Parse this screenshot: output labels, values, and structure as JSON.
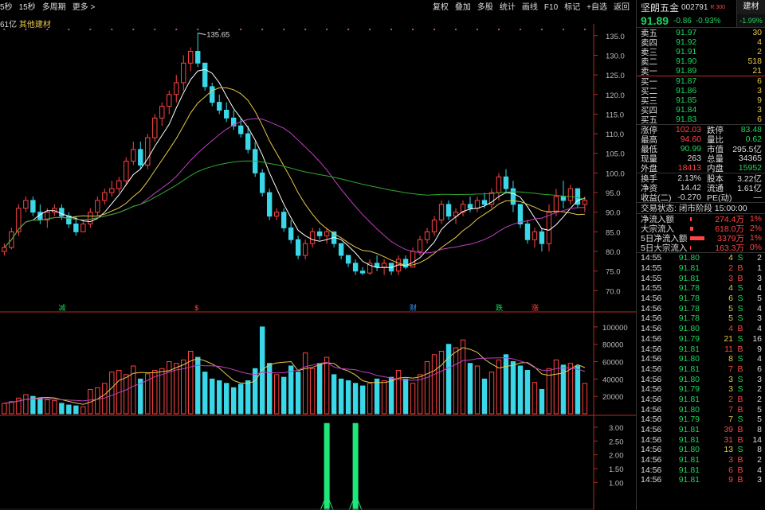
{
  "topbar": {
    "left": [
      "5秒",
      "15秒",
      "多周期",
      "更多 >"
    ],
    "right": [
      "复权",
      "叠加",
      "多股",
      "统计",
      "画线",
      "F10",
      "标记",
      "+自选",
      "返回"
    ]
  },
  "sector_line": {
    "cap": "61亿",
    "sector": "其他建材"
  },
  "header_icons": {
    "search": "search-icon",
    "settings": "gear-icon"
  },
  "colors": {
    "up": "#ff4444",
    "down": "#3ad7e8",
    "ma5": "#ffffff",
    "ma10": "#e8c84a",
    "ma20": "#c040c0",
    "ma60": "#2faa2f"
  },
  "events": [
    {
      "label": "减",
      "color": "#1fd35c"
    },
    {
      "label": "$",
      "color": "#ff4444"
    },
    {
      "label": "财",
      "color": "#3a9bff"
    },
    {
      "label": "跌",
      "color": "#1fd35c"
    },
    {
      "label": "涨",
      "color": "#ff4444"
    }
  ],
  "chart_data": [
    {
      "type": "candlestick",
      "title": "",
      "y_ticks": [
        "135.0",
        "130.0",
        "125.0",
        "120.0",
        "115.0",
        "110.0",
        "105.0",
        "100.0",
        "95.0",
        "90.0",
        "85.0",
        "80.0",
        "75.0",
        "70.0"
      ],
      "ylim": [
        65,
        138
      ],
      "max_label": "135.65",
      "candles": [
        [
          80,
          82,
          79,
          81
        ],
        [
          81,
          86,
          80.5,
          85
        ],
        [
          85,
          92,
          84,
          91
        ],
        [
          91,
          94,
          90,
          93
        ],
        [
          93,
          94,
          89,
          90
        ],
        [
          90,
          92,
          87,
          88
        ],
        [
          88,
          91,
          86,
          90
        ],
        [
          90,
          92,
          89,
          91
        ],
        [
          91,
          92,
          88,
          89
        ],
        [
          89,
          90,
          86,
          87
        ],
        [
          87,
          89,
          84,
          85
        ],
        [
          85,
          88,
          85,
          87
        ],
        [
          87,
          91,
          86,
          90
        ],
        [
          90,
          94,
          89,
          93
        ],
        [
          93,
          96,
          92,
          95
        ],
        [
          95,
          98,
          94,
          96
        ],
        [
          96,
          99,
          95,
          98
        ],
        [
          98,
          104,
          97,
          103
        ],
        [
          103,
          108,
          102,
          106
        ],
        [
          106,
          108,
          101,
          102
        ],
        [
          102,
          110,
          101,
          109
        ],
        [
          109,
          115,
          108,
          114
        ],
        [
          114,
          118,
          112,
          117
        ],
        [
          117,
          121,
          115,
          120
        ],
        [
          120,
          125,
          118,
          123
        ],
        [
          123,
          130,
          121,
          128
        ],
        [
          128,
          132,
          126,
          131
        ],
        [
          131,
          135.65,
          127,
          128
        ],
        [
          128,
          127.5,
          121,
          122
        ],
        [
          122,
          123,
          117,
          118
        ],
        [
          118,
          120,
          115,
          116
        ],
        [
          116,
          118,
          113,
          114
        ],
        [
          114,
          116,
          111,
          112
        ],
        [
          112,
          114,
          109,
          110
        ],
        [
          110,
          112,
          105,
          106
        ],
        [
          106,
          108,
          99,
          100
        ],
        [
          100,
          101,
          94,
          95
        ],
        [
          95,
          96,
          88,
          89
        ],
        [
          89,
          91,
          88,
          90
        ],
        [
          90,
          91,
          85,
          86
        ],
        [
          86,
          88,
          82,
          83
        ],
        [
          83,
          84,
          78,
          79
        ],
        [
          79,
          83,
          78,
          82
        ],
        [
          82,
          86,
          81,
          85
        ],
        [
          85,
          86,
          83,
          84
        ],
        [
          84,
          86,
          82,
          85
        ],
        [
          85,
          85,
          81,
          82
        ],
        [
          82,
          82,
          78,
          79
        ],
        [
          79,
          79,
          76,
          77
        ],
        [
          77,
          78,
          74,
          75
        ],
        [
          75,
          76,
          74,
          74.5
        ],
        [
          74.5,
          78,
          74,
          77
        ],
        [
          77,
          79,
          75,
          76
        ],
        [
          76,
          78,
          74,
          77
        ],
        [
          77,
          77,
          74,
          75
        ],
        [
          75,
          79,
          74,
          78
        ],
        [
          78,
          79,
          75.5,
          76
        ],
        [
          76,
          81,
          76,
          80
        ],
        [
          80,
          84,
          79,
          83
        ],
        [
          83,
          86,
          82,
          85
        ],
        [
          85,
          89,
          84,
          88
        ],
        [
          88,
          93,
          87,
          92
        ],
        [
          92,
          93,
          88,
          89
        ],
        [
          89,
          91,
          87,
          90
        ],
        [
          90,
          93,
          89,
          92
        ],
        [
          92,
          94,
          90,
          91
        ],
        [
          91,
          94,
          90,
          93
        ],
        [
          93,
          95,
          91,
          92
        ],
        [
          92,
          96,
          91,
          95
        ],
        [
          95,
          100,
          93,
          99
        ],
        [
          99,
          101,
          95,
          96
        ],
        [
          96,
          98,
          90,
          92
        ],
        [
          92,
          92,
          86,
          87
        ],
        [
          87,
          88,
          82,
          83
        ],
        [
          83,
          86,
          81,
          85
        ],
        [
          85,
          86,
          80,
          82
        ],
        [
          82,
          92,
          80,
          90
        ],
        [
          90,
          96,
          89,
          94
        ],
        [
          94,
          98,
          91,
          93
        ],
        [
          93,
          97,
          92,
          96
        ],
        [
          96,
          96,
          91,
          92
        ],
        [
          92,
          94,
          90,
          93
        ]
      ],
      "ma": {
        "ma5": true,
        "ma10": true,
        "ma20": true,
        "ma60": true
      }
    },
    {
      "type": "bar",
      "title": "volume",
      "y_ticks": [
        "100000",
        "80000",
        "60000",
        "40000",
        "20000"
      ],
      "ylim": [
        0,
        110000
      ],
      "values": [
        12000,
        14000,
        18000,
        22000,
        20000,
        18000,
        16000,
        15000,
        12000,
        10000,
        9000,
        8000,
        28000,
        30000,
        35000,
        48000,
        50000,
        45000,
        55000,
        40000,
        46000,
        50000,
        52000,
        60000,
        58000,
        62000,
        72000,
        65000,
        48000,
        40000,
        38000,
        35000,
        30000,
        34000,
        38000,
        52000,
        100000,
        58000,
        45000,
        42000,
        55000,
        48000,
        70000,
        52000,
        58000,
        65000,
        45000,
        40000,
        38000,
        35000,
        32000,
        35000,
        40000,
        38000,
        42000,
        50000,
        40000,
        35000,
        45000,
        60000,
        68000,
        72000,
        80000,
        76000,
        85000,
        58000,
        55000,
        40000,
        48000,
        62000,
        68000,
        60000,
        55000,
        50000,
        36000,
        28000,
        52000,
        62000,
        56000,
        58000,
        55000,
        35000
      ]
    },
    {
      "type": "bar",
      "title": "indicator",
      "y_ticks": [
        "3.00",
        "2.50",
        "2.00",
        "1.50",
        "1.00"
      ],
      "ylim": [
        0,
        3.2
      ],
      "spikes": [
        {
          "index": 45,
          "value": 3.15
        },
        {
          "index": 49,
          "value": 3.15
        }
      ]
    }
  ],
  "panel": {
    "name": "坚朗五金",
    "code": "002791",
    "rmark": "R 300",
    "sector_tag": "建材",
    "price": "91.89",
    "change": "-0.86",
    "pct": "-0.93%",
    "sector_pct": "-1.99%",
    "asks": [
      {
        "label": "卖五",
        "price": "91.97",
        "vol": "30"
      },
      {
        "label": "卖四",
        "price": "91.92",
        "vol": "4"
      },
      {
        "label": "卖三",
        "price": "91.91",
        "vol": "2"
      },
      {
        "label": "卖二",
        "price": "91.90",
        "vol": "518"
      },
      {
        "label": "卖一",
        "price": "91.89",
        "vol": "21"
      }
    ],
    "bids": [
      {
        "label": "买一",
        "price": "91.87",
        "vol": "6"
      },
      {
        "label": "买二",
        "price": "91.86",
        "vol": "3"
      },
      {
        "label": "买三",
        "price": "91.85",
        "vol": "9"
      },
      {
        "label": "买四",
        "price": "91.84",
        "vol": "3"
      },
      {
        "label": "买五",
        "price": "91.83",
        "vol": "6"
      }
    ],
    "stats1": [
      {
        "k": "涨停",
        "v": "102.03",
        "vc": "c-red",
        "k2": "跌停",
        "v2": "83.48",
        "v2c": "c-green"
      },
      {
        "k": "最高",
        "v": "94.60",
        "vc": "c-red",
        "k2": "量比",
        "v2": "0.62",
        "v2c": "c-green"
      },
      {
        "k": "最低",
        "v": "90.99",
        "vc": "c-green",
        "k2": "市值",
        "v2": "295.5亿",
        "v2c": "c-white"
      },
      {
        "k": "现量",
        "v": "263",
        "vc": "c-white",
        "k2": "总量",
        "v2": "34365",
        "v2c": "c-white"
      },
      {
        "k": "外盘",
        "v": "18413",
        "vc": "c-red",
        "k2": "内盘",
        "v2": "15952",
        "v2c": "c-green"
      }
    ],
    "stats2": [
      {
        "k": "换手",
        "v": "2.13%",
        "vc": "c-white",
        "k2": "股本",
        "v2": "3.22亿",
        "v2c": "c-white"
      },
      {
        "k": "净资",
        "v": "14.42",
        "vc": "c-white",
        "k2": "流通",
        "v2": "1.61亿",
        "v2c": "c-white"
      },
      {
        "k": "收益(二)",
        "v": "-0.270",
        "vc": "c-white",
        "k2": "PE(动)",
        "v2": "—",
        "v2c": "c-white"
      }
    ],
    "status": "交易状态: 闭市阶段 15:00:00",
    "flows": [
      {
        "k": "净流入额",
        "v": "274.4万",
        "p": "1%",
        "bar": 0.1
      },
      {
        "k": "大宗流入",
        "v": "618.0万",
        "p": "2%",
        "bar": 0.2
      },
      {
        "k": "5日净流入额",
        "v": "3379万",
        "p": "1%",
        "bar": 1.0
      },
      {
        "k": "5日大宗流入",
        "v": "163.3万",
        "p": "0%",
        "bar": 0.05
      }
    ],
    "ticks": [
      {
        "t": "14:55",
        "p": "91.80",
        "q": "4",
        "bs": "S",
        "n": "2"
      },
      {
        "t": "14:55",
        "p": "91.81",
        "q": "2",
        "bs": "B",
        "n": "1"
      },
      {
        "t": "14:55",
        "p": "91.81",
        "q": "3",
        "bs": "B",
        "n": "3"
      },
      {
        "t": "14:55",
        "p": "91.78",
        "q": "4",
        "bs": "S",
        "n": "4"
      },
      {
        "t": "14:56",
        "p": "91.78",
        "q": "6",
        "bs": "S",
        "n": "5"
      },
      {
        "t": "14:56",
        "p": "91.78",
        "q": "5",
        "bs": "S",
        "n": "4"
      },
      {
        "t": "14:56",
        "p": "91.78",
        "q": "5",
        "bs": "S",
        "n": "3"
      },
      {
        "t": "14:56",
        "p": "91.80",
        "q": "4",
        "bs": "B",
        "n": "4"
      },
      {
        "t": "14:56",
        "p": "91.79",
        "q": "21",
        "bs": "S",
        "n": "16"
      },
      {
        "t": "14:56",
        "p": "91.81",
        "q": "11",
        "bs": "B",
        "n": "9"
      },
      {
        "t": "14:56",
        "p": "91.80",
        "q": "8",
        "bs": "S",
        "n": "4"
      },
      {
        "t": "14:56",
        "p": "91.81",
        "q": "7",
        "bs": "B",
        "n": "6"
      },
      {
        "t": "14:56",
        "p": "91.80",
        "q": "3",
        "bs": "S",
        "n": "3"
      },
      {
        "t": "14:56",
        "p": "91.79",
        "q": "3",
        "bs": "S",
        "n": "2"
      },
      {
        "t": "14:56",
        "p": "91.81",
        "q": "2",
        "bs": "B",
        "n": "2"
      },
      {
        "t": "14:56",
        "p": "91.80",
        "q": "7",
        "bs": "B",
        "n": "5"
      },
      {
        "t": "14:56",
        "p": "91.79",
        "q": "7",
        "bs": "S",
        "n": "5"
      },
      {
        "t": "14:56",
        "p": "91.81",
        "q": "39",
        "bs": "B",
        "n": "8"
      },
      {
        "t": "14:56",
        "p": "91.81",
        "q": "31",
        "bs": "B",
        "n": "14"
      },
      {
        "t": "14:56",
        "p": "91.80",
        "q": "13",
        "bs": "S",
        "n": "8"
      },
      {
        "t": "14:56",
        "p": "91.81",
        "q": "3",
        "bs": "B",
        "n": "2"
      },
      {
        "t": "14:56",
        "p": "91.81",
        "q": "6",
        "bs": "B",
        "n": "4"
      },
      {
        "t": "14:56",
        "p": "91.81",
        "q": "9",
        "bs": "B",
        "n": "3"
      }
    ]
  }
}
